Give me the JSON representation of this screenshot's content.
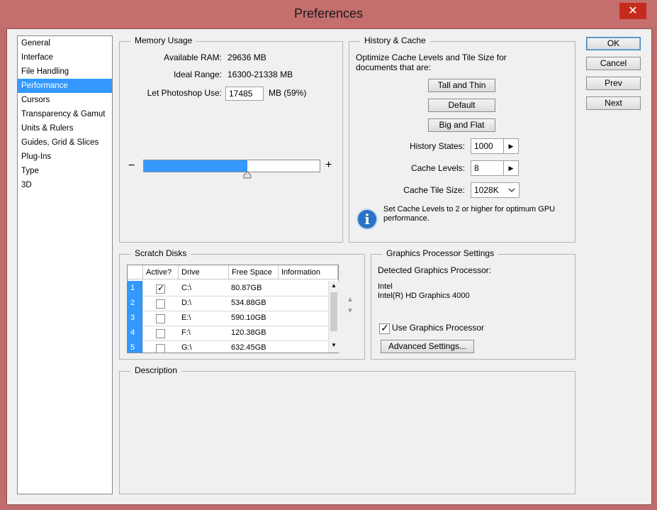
{
  "window": {
    "title": "Preferences",
    "close_symbol": "✕"
  },
  "categories": [
    {
      "label": "General",
      "selected": false
    },
    {
      "label": "Interface",
      "selected": false
    },
    {
      "label": "File Handling",
      "selected": false
    },
    {
      "label": "Performance",
      "selected": true
    },
    {
      "label": "Cursors",
      "selected": false
    },
    {
      "label": "Transparency & Gamut",
      "selected": false
    },
    {
      "label": "Units & Rulers",
      "selected": false
    },
    {
      "label": "Guides, Grid & Slices",
      "selected": false
    },
    {
      "label": "Plug-Ins",
      "selected": false
    },
    {
      "label": "Type",
      "selected": false
    },
    {
      "label": "3D",
      "selected": false
    }
  ],
  "memory": {
    "title": "Memory Usage",
    "available_label": "Available RAM:",
    "available_value": "29636 MB",
    "ideal_label": "Ideal Range:",
    "ideal_value": "16300-21338 MB",
    "let_label": "Let Photoshop Use:",
    "let_value": "17485",
    "let_suffix": "MB (59%)",
    "slider_fraction": 0.59,
    "minus": "−",
    "plus": "+"
  },
  "history": {
    "title": "History & Cache",
    "description": "Optimize Cache Levels and Tile Size for documents that are:",
    "btn_tall_thin": "Tall and Thin",
    "btn_default": "Default",
    "btn_big_flat": "Big and Flat",
    "states_label": "History States:",
    "states_value": "1000",
    "levels_label": "Cache Levels:",
    "levels_value": "8",
    "tile_label": "Cache Tile Size:",
    "tile_value": "1028K",
    "info_text": "Set Cache Levels to 2 or higher for optimum GPU performance.",
    "info_icon_glyph": "i"
  },
  "buttons": {
    "ok": "OK",
    "cancel": "Cancel",
    "prev": "Prev",
    "next": "Next"
  },
  "scratch": {
    "title": "Scratch Disks",
    "columns": [
      "Active?",
      "Drive",
      "Free Space",
      "Information"
    ],
    "rows": [
      {
        "num": "1",
        "active": true,
        "drive": "C:\\",
        "free": "80.87GB",
        "info": ""
      },
      {
        "num": "2",
        "active": false,
        "drive": "D:\\",
        "free": "534.88GB",
        "info": ""
      },
      {
        "num": "3",
        "active": false,
        "drive": "E:\\",
        "free": "590.10GB",
        "info": ""
      },
      {
        "num": "4",
        "active": false,
        "drive": "F:\\",
        "free": "120.38GB",
        "info": ""
      },
      {
        "num": "5",
        "active": false,
        "drive": "G:\\",
        "free": "632.45GB",
        "info": ""
      }
    ],
    "check_glyph": "✓"
  },
  "gpu": {
    "title": "Graphics Processor Settings",
    "detected_label": "Detected Graphics Processor:",
    "vendor": "Intel",
    "model": "Intel(R) HD Graphics 4000",
    "use_label": "Use Graphics Processor",
    "use_checked": true,
    "advanced_label": "Advanced Settings..."
  },
  "description": {
    "title": "Description"
  },
  "colors": {
    "accent": "#3399ff",
    "titlebar": "#c56e6e",
    "close": "#c42b1c"
  }
}
